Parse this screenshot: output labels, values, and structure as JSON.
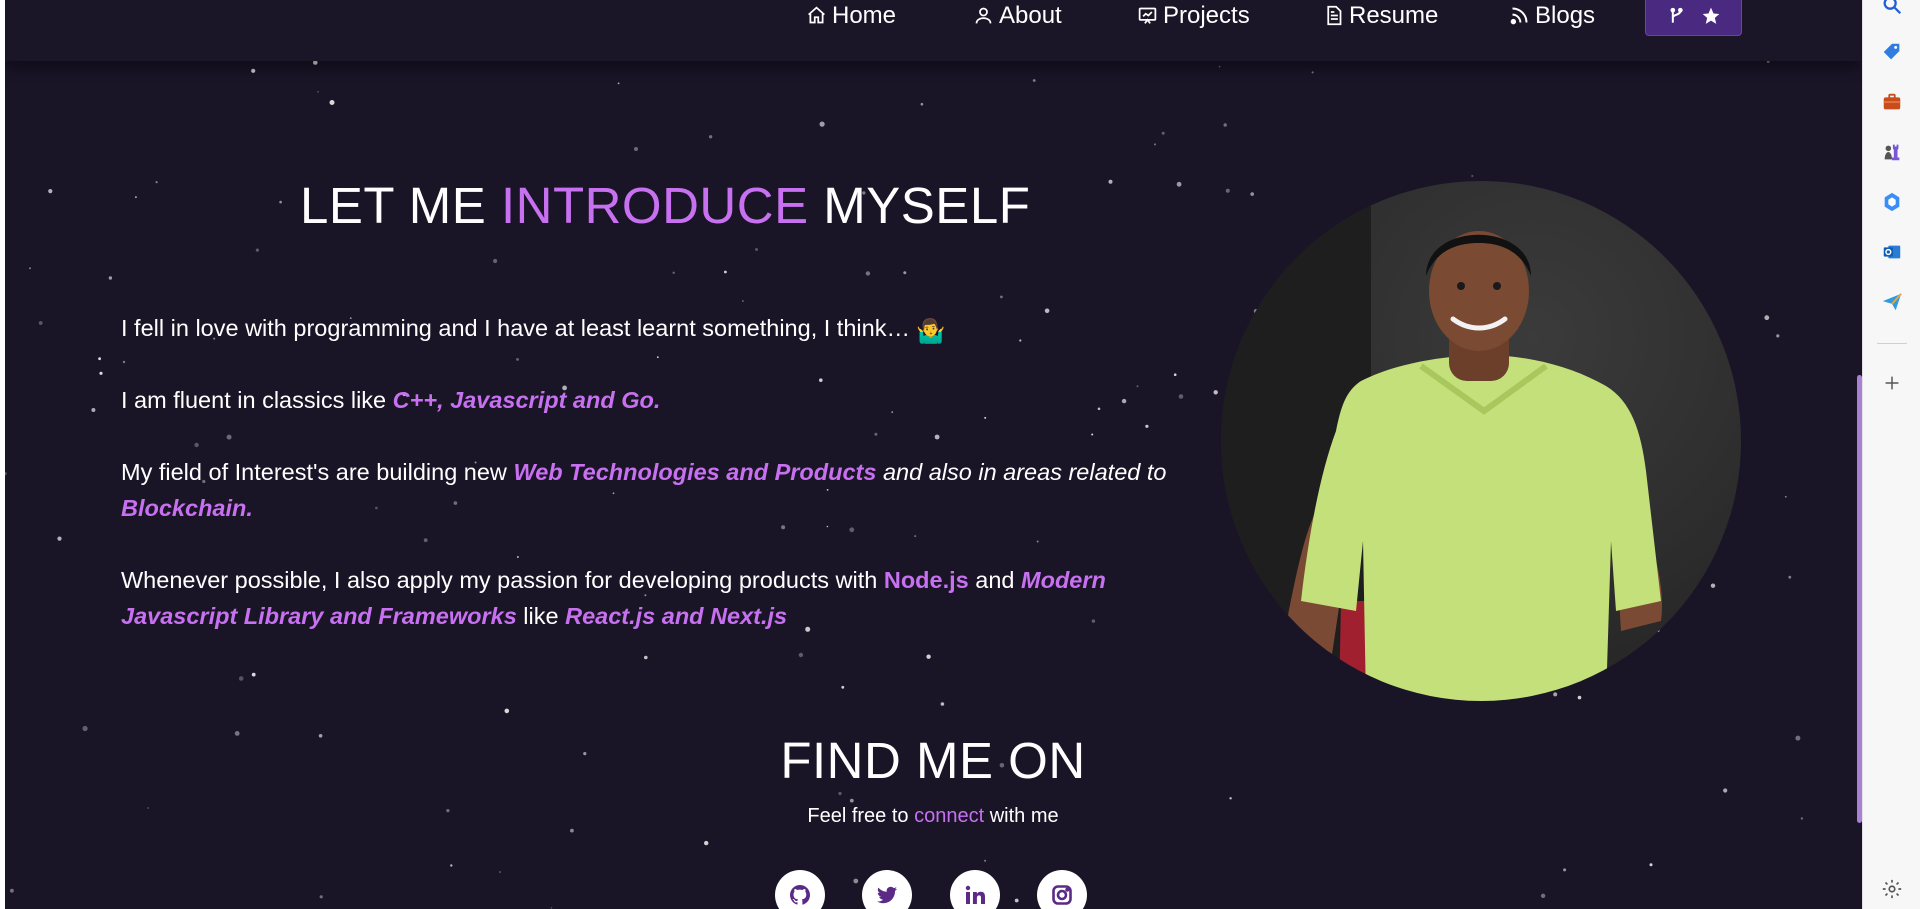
{
  "nav": {
    "items": [
      {
        "label": "Home",
        "icon": "home-icon"
      },
      {
        "label": "About",
        "icon": "user-icon"
      },
      {
        "label": "Projects",
        "icon": "projects-icon"
      },
      {
        "label": "Resume",
        "icon": "document-icon"
      },
      {
        "label": "Blogs",
        "icon": "blog-icon"
      }
    ],
    "fork_button_icons": [
      "fork-icon",
      "star-icon"
    ]
  },
  "intro": {
    "title_part1": "LET ME ",
    "title_highlight": "INTRODUCE",
    "title_part2": " MYSELF",
    "p1_text": "I fell in love with programming and I have at least learnt something, I think…",
    "p1_emoji": "🤷‍♂️",
    "p2_text": "I am fluent in classics like ",
    "p2_em": "C++, Javascript and Go.",
    "p3_text": "My field of Interest's are building new ",
    "p3_em1": "Web Technologies and Products",
    "p3_it1": " and also in areas related to ",
    "p3_em2": "Blockchain.",
    "p4_text1": "Whenever possible, I also apply my passion for developing products with ",
    "p4_b1": "Node.js",
    "p4_text2": " and ",
    "p4_em1": "Modern Javascript Library and Frameworks",
    "p4_text3": "  like ",
    "p4_em2": "React.js and Next.js"
  },
  "find": {
    "title": "FIND ME ON",
    "sub_text1": "Feel free to ",
    "sub_highlight": "connect",
    "sub_text2": " with me",
    "socials": [
      "github-icon",
      "twitter-icon",
      "linkedin-icon",
      "instagram-icon"
    ]
  },
  "colors": {
    "background": "#1a1427",
    "accent": "#c770f0",
    "fork_button": "#4a2a80"
  },
  "sidebar": {
    "icons": [
      "search-icon",
      "tag-icon",
      "briefcase-icon",
      "chess-icon",
      "copilot-icon",
      "outlook-icon",
      "send-icon",
      "add-icon",
      "settings-icon"
    ]
  }
}
